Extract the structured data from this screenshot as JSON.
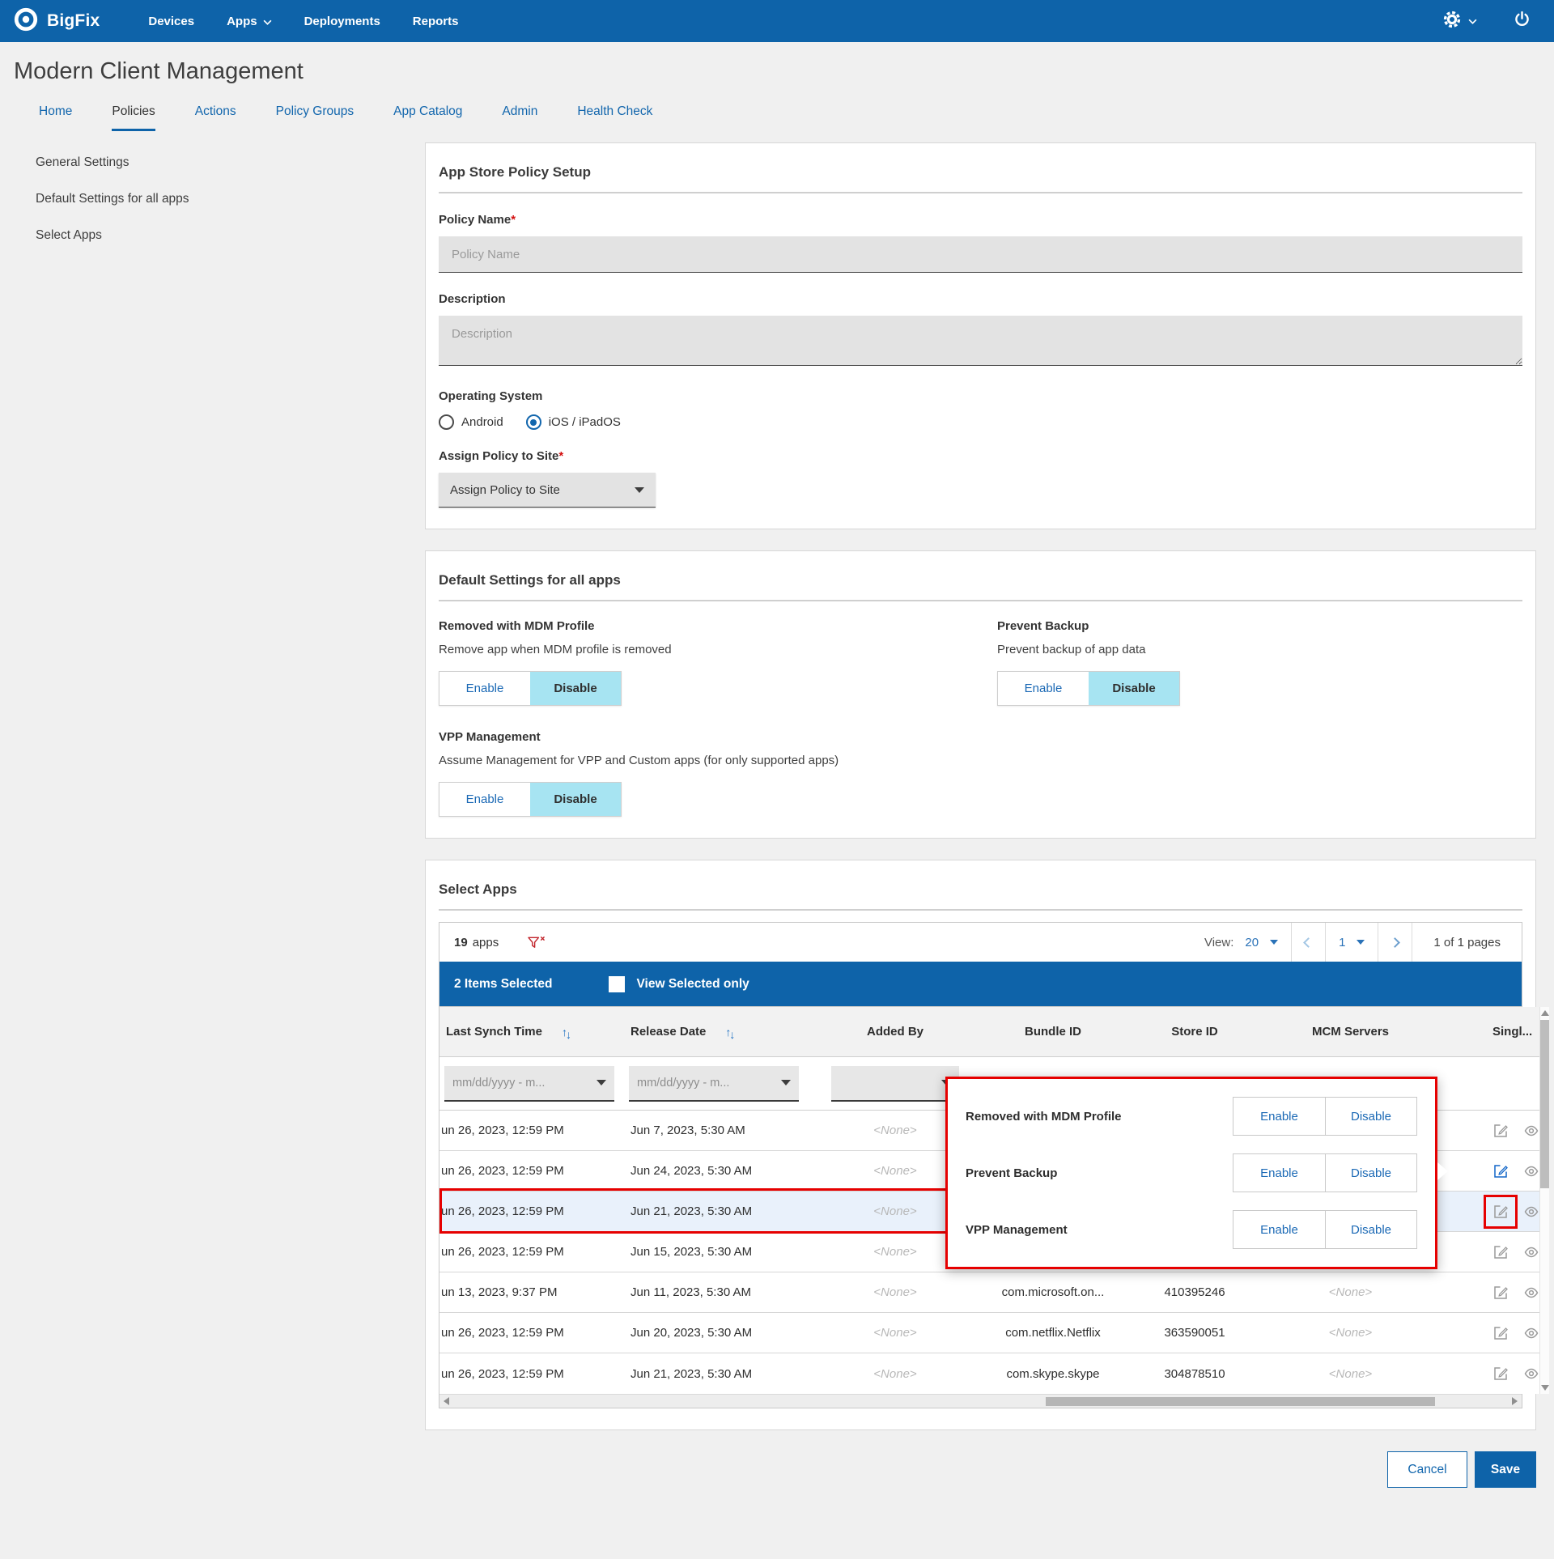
{
  "header": {
    "brand": "BigFix",
    "nav": [
      {
        "label": "Devices"
      },
      {
        "label": "Apps"
      },
      {
        "label": "Deployments"
      },
      {
        "label": "Reports"
      }
    ]
  },
  "page_title": "Modern Client Management",
  "tabs": [
    {
      "label": "Home"
    },
    {
      "label": "Policies"
    },
    {
      "label": "Actions"
    },
    {
      "label": "Policy Groups"
    },
    {
      "label": "App Catalog"
    },
    {
      "label": "Admin"
    },
    {
      "label": "Health Check"
    }
  ],
  "active_tab": "Policies",
  "sidebar": {
    "items": [
      {
        "label": "General Settings"
      },
      {
        "label": "Default Settings for all apps"
      },
      {
        "label": "Select Apps"
      }
    ]
  },
  "policy_setup": {
    "title": "App Store Policy Setup",
    "policy_name_label": "Policy Name",
    "required_mark": "*",
    "policy_name_placeholder": "Policy Name",
    "policy_name_value": "",
    "description_label": "Description",
    "description_placeholder": "Description",
    "description_value": "",
    "os_label": "Operating System",
    "os_android": "Android",
    "os_ios": "iOS / iPadOS",
    "os_selected": "iOS / iPadOS",
    "assign_label": "Assign Policy to Site",
    "assign_value": "Assign Policy to Site"
  },
  "default_settings": {
    "title": "Default Settings for all apps",
    "enable_label": "Enable",
    "disable_label": "Disable",
    "settings": [
      {
        "name": "Removed with MDM Profile",
        "description": "Remove app when MDM profile is removed",
        "selected": "Disable"
      },
      {
        "name": "Prevent Backup",
        "description": "Prevent backup of app data",
        "selected": "Disable"
      },
      {
        "name": "VPP Management",
        "description": "Assume Management for VPP and Custom apps (for only supported apps)",
        "selected": "Disable"
      }
    ]
  },
  "select_apps": {
    "title": "Select Apps",
    "count": "19",
    "count_suffix": "apps",
    "view_label": "View:",
    "page_size": "20",
    "page_number": "1",
    "page_info": "1 of 1 pages",
    "selection_bar": {
      "selected_text": "2 Items Selected",
      "view_selected_label": "View Selected only",
      "checkbox_checked": false
    },
    "columns": [
      "Last Synch Time",
      "Release Date",
      "Added By",
      "Bundle ID",
      "Store ID",
      "MCM Servers",
      "Singl..."
    ],
    "date_filter_placeholder": "mm/dd/yyyy - m...",
    "rows": [
      {
        "last_synch_time": "un 26, 2023, 12:59 PM",
        "release_date": "Jun 7, 2023, 5:30 AM",
        "added_by": "<None>",
        "bundle_id": "",
        "store_id": "",
        "mcm_servers": ""
      },
      {
        "last_synch_time": "un 26, 2023, 12:59 PM",
        "release_date": "Jun 24, 2023, 5:30 AM",
        "added_by": "<None>",
        "bundle_id": "",
        "store_id": "",
        "mcm_servers": ""
      },
      {
        "last_synch_time": "un 26, 2023, 12:59 PM",
        "release_date": "Jun 21, 2023, 5:30 AM",
        "added_by": "<None>",
        "bundle_id": "",
        "store_id": "",
        "mcm_servers": ""
      },
      {
        "last_synch_time": "un 26, 2023, 12:59 PM",
        "release_date": "Jun 15, 2023, 5:30 AM",
        "added_by": "<None>",
        "bundle_id": "",
        "store_id": "",
        "mcm_servers": ""
      },
      {
        "last_synch_time": "un 13, 2023, 9:37 PM",
        "release_date": "Jun 11, 2023, 5:30 AM",
        "added_by": "<None>",
        "bundle_id": "com.microsoft.on...",
        "store_id": "410395246",
        "mcm_servers": "<None>"
      },
      {
        "last_synch_time": "un 26, 2023, 12:59 PM",
        "release_date": "Jun 20, 2023, 5:30 AM",
        "added_by": "<None>",
        "bundle_id": "com.netflix.Netflix",
        "store_id": "363590051",
        "mcm_servers": "<None>"
      },
      {
        "last_synch_time": "un 26, 2023, 12:59 PM",
        "release_date": "Jun 21, 2023, 5:30 AM",
        "added_by": "<None>",
        "bundle_id": "com.skype.skype",
        "store_id": "304878510",
        "mcm_servers": "<None>"
      }
    ]
  },
  "popup": {
    "enable_label": "Enable",
    "disable_label": "Disable",
    "items": [
      {
        "label": "Removed with MDM Profile"
      },
      {
        "label": "Prevent Backup"
      },
      {
        "label": "VPP Management"
      }
    ]
  },
  "footer": {
    "cancel_label": "Cancel",
    "save_label": "Save"
  },
  "colors": {
    "accent": "#0e63a9",
    "toggle_selected": "#a7e4f2",
    "annotation_red": "#e60000",
    "row_highlight": "#e9f1fb"
  }
}
